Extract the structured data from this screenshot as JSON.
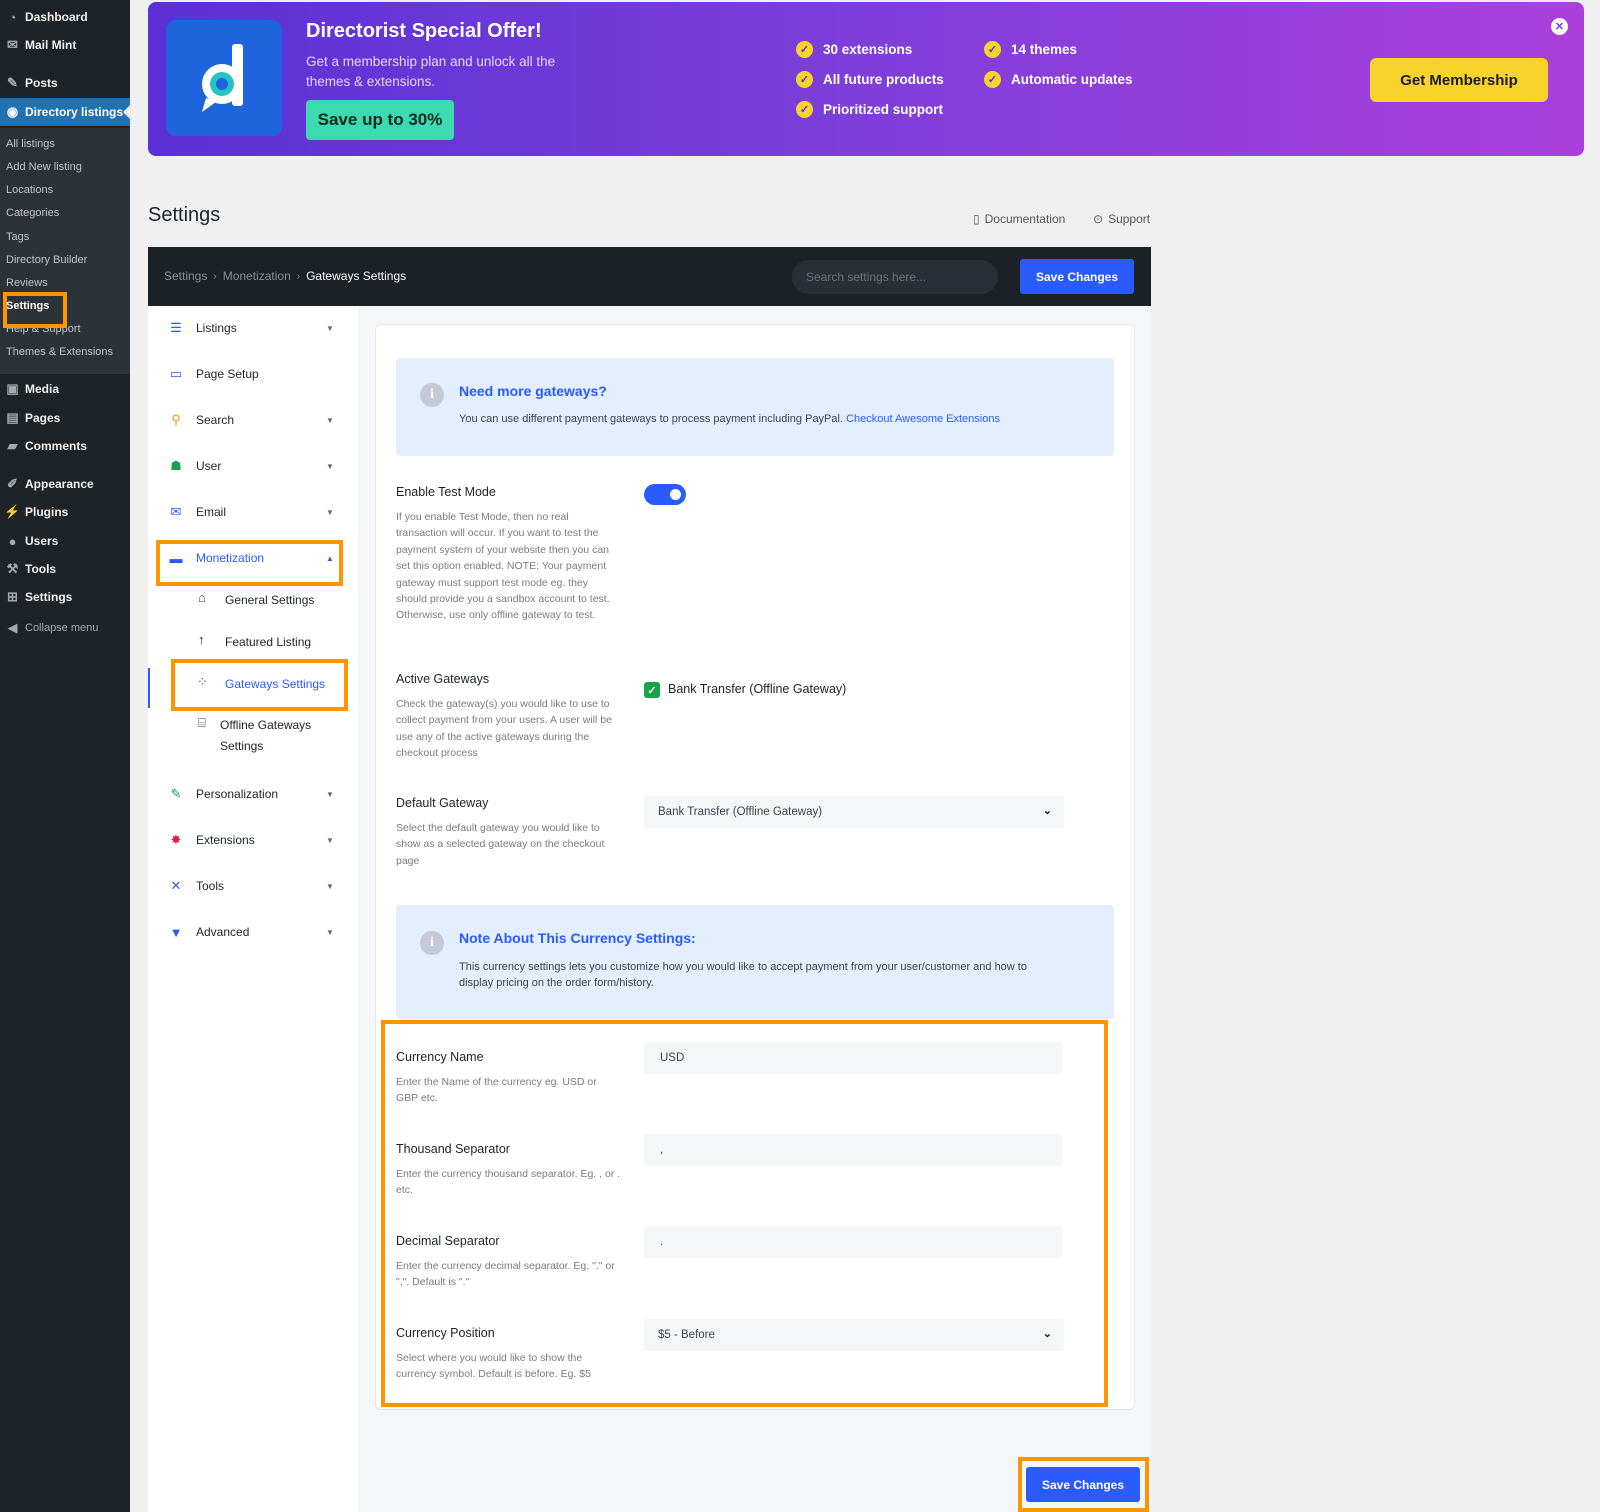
{
  "wp_menu": {
    "top": [
      {
        "label": "Dashboard",
        "icon": "dashboard-icon"
      },
      {
        "label": "Mail Mint",
        "icon": "mail-icon"
      },
      {
        "label": "Posts",
        "icon": "pin-icon"
      },
      {
        "label": "Directory listings",
        "icon": "directory-icon"
      }
    ],
    "submenu": [
      "All listings",
      "Add New listing",
      "Locations",
      "Categories",
      "Tags",
      "Directory Builder",
      "Reviews",
      "Settings",
      "Help & Support",
      "Themes & Extensions"
    ],
    "bottom": [
      {
        "label": "Media",
        "icon": "media-icon"
      },
      {
        "label": "Pages",
        "icon": "pages-icon"
      },
      {
        "label": "Comments",
        "icon": "comments-icon"
      },
      {
        "label": "Appearance",
        "icon": "brush-icon"
      },
      {
        "label": "Plugins",
        "icon": "plugin-icon"
      },
      {
        "label": "Users",
        "icon": "users-icon"
      },
      {
        "label": "Tools",
        "icon": "wrench-icon"
      },
      {
        "label": "Settings",
        "icon": "settings-icon"
      }
    ],
    "collapse": "Collapse menu"
  },
  "promo": {
    "title": "Directorist Special Offer!",
    "description": "Get a membership plan and unlock all the themes & extensions.",
    "save_label": "Save up to 30%",
    "features": [
      "30 extensions",
      "14 themes",
      "All future products",
      "Automatic updates",
      "Prioritized support"
    ],
    "cta": "Get Membership"
  },
  "page": {
    "title": "Settings",
    "documentation": "Documentation",
    "support": "Support"
  },
  "header": {
    "breadcrumb": [
      "Settings",
      "Monetization",
      "Gateways Settings"
    ],
    "search_placeholder": "Search settings here...",
    "save_label": "Save Changes"
  },
  "nav": {
    "items": [
      "Listings",
      "Page Setup",
      "Search",
      "User",
      "Email",
      "Monetization",
      "Personalization",
      "Extensions",
      "Tools",
      "Advanced"
    ],
    "monetization_sub": [
      "General Settings",
      "Featured Listing",
      "Gateways Settings",
      "Offline Gateways",
      "Settings"
    ]
  },
  "notice_gateways": {
    "title": "Need more gateways?",
    "text": "You can use different payment gateways to process payment including PayPal.",
    "link": "Checkout Awesome Extensions"
  },
  "fields": {
    "test_mode": {
      "label": "Enable Test Mode",
      "desc": "If you enable Test Mode, then no real transaction will occur. If you want to test the payment system of your website then you can set this option enabled. NOTE: Your payment gateway must support test mode eg. they should provide you a sandbox account to test. Otherwise, use only offline gateway to test.",
      "enabled": true
    },
    "active_gateways": {
      "label": "Active Gateways",
      "desc": "Check the gateway(s) you would like to use to collect payment from your users. A user will be use any of the active gateways during the checkout process",
      "option": "Bank Transfer (Offline Gateway)",
      "checked": true
    },
    "default_gateway": {
      "label": "Default Gateway",
      "desc": "Select the default gateway you would like to show as a selected gateway on the checkout page",
      "value": "Bank Transfer (Offline Gateway)"
    },
    "currency_name": {
      "label": "Currency Name",
      "desc": "Enter the Name of the currency eg. USD or GBP etc.",
      "value": "USD"
    },
    "thousand_separator": {
      "label": "Thousand Separator",
      "desc": "Enter the currency thousand separator. Eg. , or . etc.",
      "value": ","
    },
    "decimal_separator": {
      "label": "Decimal Separator",
      "desc": "Enter the currency decimal separator. Eg. \".\" or \",\". Default is \".\"",
      "value": "."
    },
    "currency_position": {
      "label": "Currency Position",
      "desc": "Select where you would like to show the currency symbol. Default is before. Eg. $5",
      "value": "$5 - Before"
    }
  },
  "notice_currency": {
    "title": "Note About This Currency Settings:",
    "text": "This currency settings lets you customize how you would like to accept payment from your user/customer and how to display pricing on the order form/history."
  },
  "footer": {
    "save_label": "Save Changes"
  },
  "colors": {
    "accent": "#2a5bff",
    "highlight": "#ff9500",
    "wp_dark": "#1d2327",
    "wp_blue": "#2271b1"
  }
}
